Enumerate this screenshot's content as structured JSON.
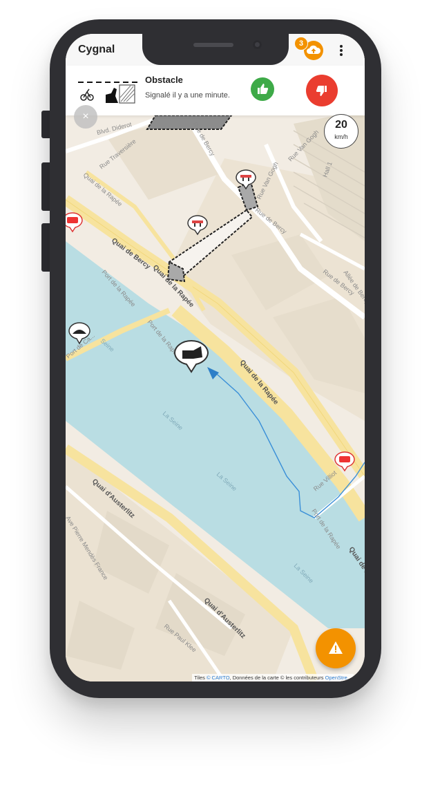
{
  "app": {
    "title": "Cygnal",
    "upload_count": "3"
  },
  "notification": {
    "title": "Obstacle",
    "subtitle": "Signalé il y a une minute."
  },
  "close_label": "×",
  "speed": {
    "value": "20",
    "unit": "km/h"
  },
  "map": {
    "streets": {
      "blvd_diderot": "Blvd. Diderot",
      "rue_traversiere": "Rue Traversière",
      "rue_de_bercy_top": "Rue de Bercy",
      "rue_van_gogh_top": "Rue Van Gogh",
      "hall1": "Hall 1",
      "rue_van_gogh_mid": "Rue Van Gogh",
      "rue_de_bercy_mid": "Rue de Bercy",
      "quai_rapee_small": "Quai de la Rapée",
      "allee_bercy": "Allée de Bercy",
      "rue_de_bercy_right": "Rue de Bercy",
      "quai_de_bercy": "Quai de Bercy",
      "quai_rapee_1": "Quai de la Rapée",
      "port_rapee_1": "Port de la Rapée",
      "port_rapee_2": "Port de la Rapée",
      "port_de_ca": "Port de Ca...",
      "seine_1": "Seine",
      "quai_rapee_2": "Quai de la Rapée",
      "la_seine_1": "La Seine",
      "la_seine_2": "La Seine",
      "la_seine_3": "La Seine",
      "rue_villiot": "Rue Villiot",
      "port_rapee_3": "Port de la Rapée",
      "quai_rapee_3": "Quai de la...",
      "quai_austerlitz_1": "Quai d'Austerlitz",
      "ave_mendes": "Ave Pierre Mendès France",
      "quai_austerlitz_2": "Quai d'Austerlitz",
      "rue_paul_klee": "Rue Paul Klee"
    }
  },
  "attribution": {
    "prefix": "Tiles ",
    "carto": "© CARTO",
    "middle": ", Données de la carte © les contributeurs ",
    "osm": "OpenStre..."
  },
  "icons": {
    "upload": "cloud-upload-icon",
    "menu": "more-vert-icon",
    "thumb_up": "thumb-up-icon",
    "thumb_down": "thumb-down-icon",
    "report": "warning-icon",
    "obstacle": "obstacle-icon"
  },
  "colors": {
    "accent": "#f39200",
    "upvote": "#3eaa48",
    "downvote": "#ea3d2f",
    "water": "#b9dde3",
    "land": "#f2ece3",
    "road": "#f7e39e",
    "route": "#3a8fd8"
  }
}
